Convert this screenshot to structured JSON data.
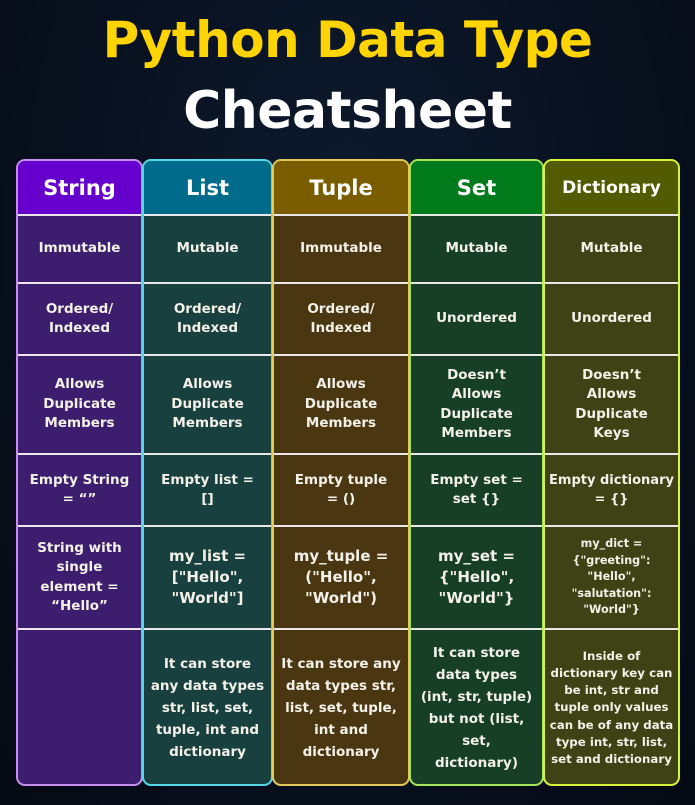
{
  "title": {
    "line1": "Python Data Type",
    "line2": "Cheatsheet",
    "line1_color": "#ffd400",
    "line2_color": "#ffffff"
  },
  "columns": [
    {
      "name": "String",
      "header_color": "#6600cc",
      "body_color": "#3d1d6e",
      "border_color": "#c58ef0",
      "mutability": "Immutable",
      "ordering": "Ordered/ Indexed",
      "duplicates": "Allows Duplicate Members",
      "empty": "Empty String = “”",
      "example": "String with single element = “Hello”",
      "notes": ""
    },
    {
      "name": "List",
      "header_color": "#006b8a",
      "body_color": "#17403f",
      "border_color": "#56d8e8",
      "mutability": "Mutable",
      "ordering": "Ordered/ Indexed",
      "duplicates": "Allows Duplicate Members",
      "empty": "Empty list = []",
      "example": "my_list = [\"Hello\", \"World\"]",
      "notes": "It can store any data types str, list, set, tuple, int and dictionary"
    },
    {
      "name": "Tuple",
      "header_color": "#7a5d00",
      "body_color": "#4a3712",
      "border_color": "#e3c95a",
      "mutability": "Immutable",
      "ordering": "Ordered/ Indexed",
      "duplicates": "Allows Duplicate Members",
      "empty": "Empty tuple = ()",
      "example": "my_tuple = (\"Hello\", \"World\")",
      "notes": "It can store any data types str, list, set, tuple, int and dictionary"
    },
    {
      "name": "Set",
      "header_color": "#007a1a",
      "body_color": "#163f26",
      "border_color": "#a6e45a",
      "mutability": "Mutable",
      "ordering": "Unordered",
      "duplicates": "Doesn’t Allows Duplicate Members",
      "empty": "Empty set = set {}",
      "example": "my_set = {\"Hello\", \"World\"}",
      "notes": "It can store data types (int, str, tuple) but not (list, set, dictionary)"
    },
    {
      "name": "Dictionary",
      "header_color": "#525b00",
      "body_color": "#3e4214",
      "border_color": "#d8f23a",
      "mutability": "Mutable",
      "ordering": "Unordered",
      "duplicates": "Doesn’t Allows Duplicate Keys",
      "empty": "Empty dictionary = {}",
      "example": "my_dict = {\"greeting\": \"Hello\", \"salutation\": \"World\"}",
      "notes": "Inside of dictionary key can be int, str and tuple only values can be of any data type int, str, list, set and dictionary"
    }
  ]
}
